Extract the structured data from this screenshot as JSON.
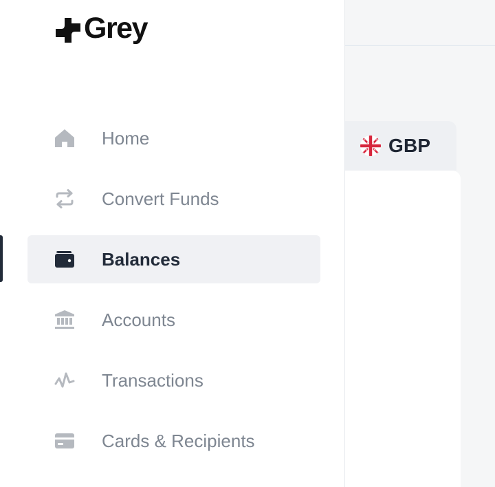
{
  "brand": {
    "name": "Grey",
    "logo_icon": "grey-logo-mark"
  },
  "nav": {
    "items": [
      {
        "label": "Home",
        "icon": "home-icon",
        "active": false
      },
      {
        "label": "Convert Funds",
        "icon": "swap-arrows-icon",
        "active": false
      },
      {
        "label": "Balances",
        "icon": "wallet-icon",
        "active": true
      },
      {
        "label": "Accounts",
        "icon": "bank-icon",
        "active": false
      },
      {
        "label": "Transactions",
        "icon": "activity-icon",
        "active": false
      },
      {
        "label": "Cards & Recipients",
        "icon": "card-icon",
        "active": false
      }
    ]
  },
  "currency_tab": {
    "code": "GBP",
    "flag_icon": "uk-flag-icon"
  },
  "colors": {
    "active_text": "#222b39",
    "inactive_text": "#7e8691",
    "active_bg": "#f0f1f4",
    "icon_inactive": "#b5b9bf",
    "icon_active": "#222b39",
    "flag_red": "#d7263d"
  }
}
